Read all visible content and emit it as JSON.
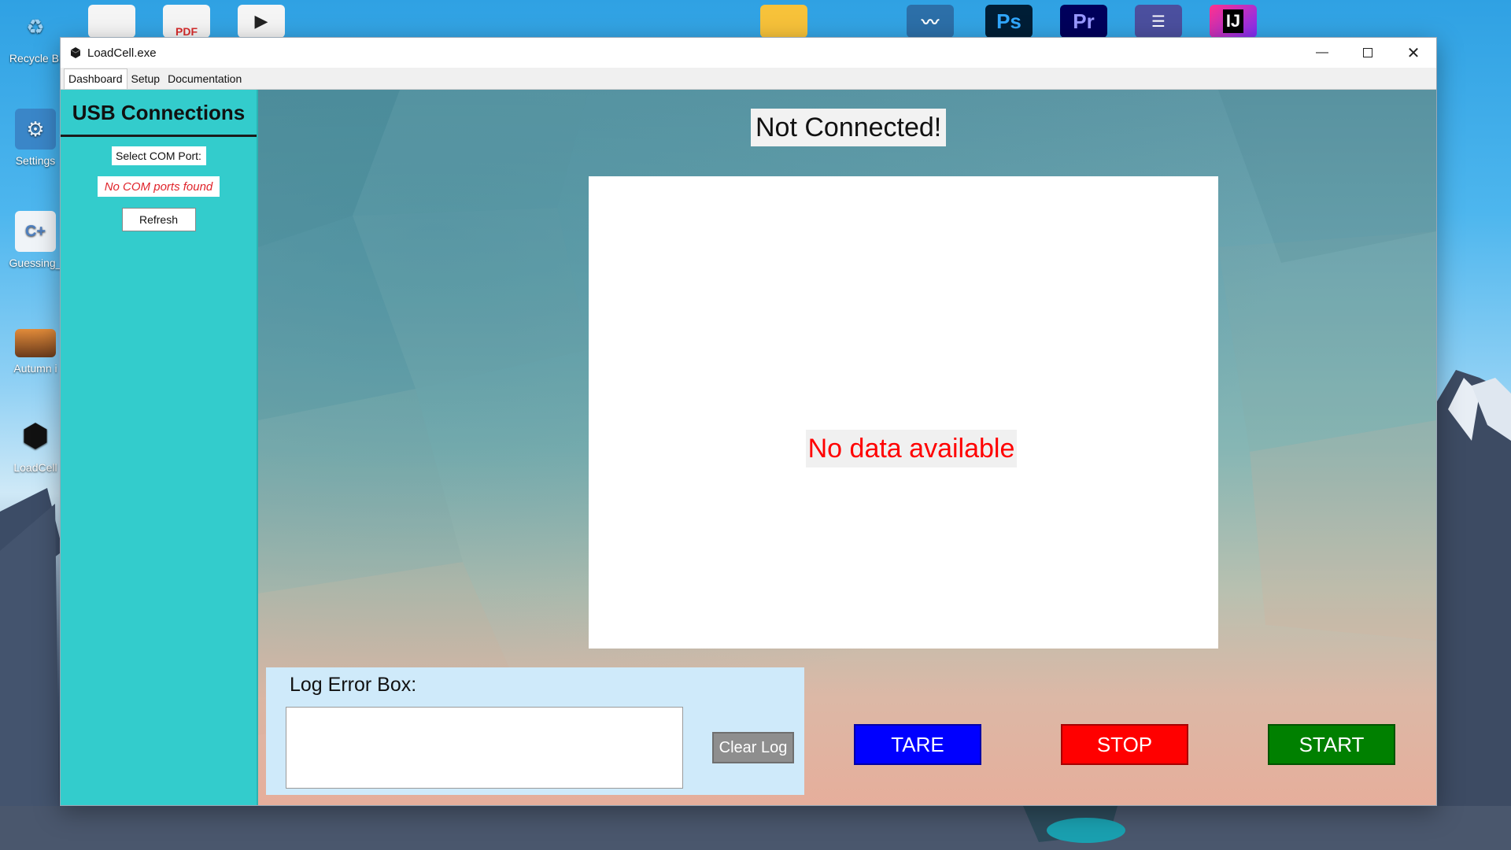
{
  "desktop": {
    "icons": [
      {
        "label": "Recycle Bi",
        "icon": "recycle-bin-icon"
      },
      {
        "label": "Settings",
        "icon": "settings-icon"
      },
      {
        "label": "Guessing_",
        "icon": "cpp-file-icon"
      },
      {
        "label": "Autumn i",
        "icon": "image-file-icon"
      },
      {
        "label": "LoadCell",
        "icon": "loadcell-app-icon"
      }
    ],
    "top_icons": [
      {
        "icon": "document-icon"
      },
      {
        "icon": "pdf-file-icon",
        "text": "PDF"
      },
      {
        "icon": "media-player-icon"
      },
      {
        "icon": "folder-icon"
      },
      {
        "icon": "waveform-app-icon"
      },
      {
        "icon": "photoshop-icon",
        "text": "Ps"
      },
      {
        "icon": "premiere-icon",
        "text": "Pr"
      },
      {
        "icon": "mixer-app-icon"
      },
      {
        "icon": "intellij-icon",
        "text": "IJ"
      }
    ]
  },
  "window": {
    "title": "LoadCell.exe",
    "tabs": [
      "Dashboard",
      "Setup",
      "Documentation"
    ],
    "active_tab": "Dashboard"
  },
  "sidebar": {
    "heading": "USB Connections",
    "com_port_label": "Select COM Port:",
    "com_port_status": "No COM ports found",
    "refresh_label": "Refresh"
  },
  "main": {
    "connection_status": "Not Connected!",
    "plot_message": "No data available",
    "log": {
      "label": "Log Error Box:",
      "content": "",
      "clear_label": "Clear Log"
    },
    "buttons": {
      "tare": "TARE",
      "stop": "STOP",
      "start": "START"
    }
  },
  "colors": {
    "sidebar": "#33cccc",
    "tare": "#0000ff",
    "stop": "#ff0000",
    "start": "#008000",
    "warning_text": "#e0242b"
  }
}
